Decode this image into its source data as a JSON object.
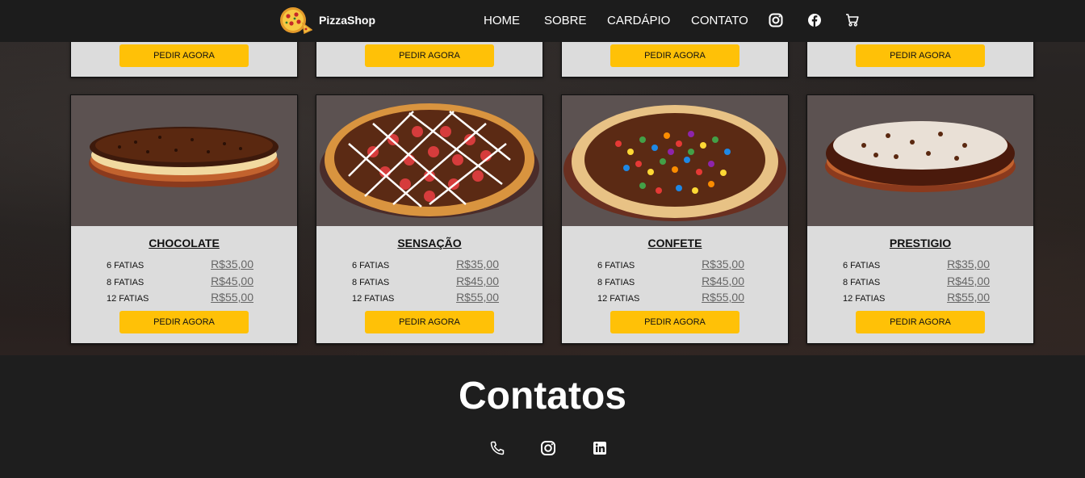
{
  "nav": {
    "brand": "PizzaShop",
    "links": [
      "HOME",
      "SOBRE",
      "CARDÁPIO",
      "CONTATO"
    ],
    "icons": [
      "instagram-icon",
      "facebook-icon",
      "cart-icon"
    ]
  },
  "top_row": {
    "button_label": "PEDIR AGORA"
  },
  "pizzas": [
    {
      "name": "CHOCOLATE",
      "prices": [
        {
          "label": "6 FATIAS",
          "value": "R$35,00"
        },
        {
          "label": "8 FATIAS",
          "value": "R$45,00"
        },
        {
          "label": "12 FATIAS",
          "value": "R$55,00"
        }
      ],
      "button": "PEDIR AGORA"
    },
    {
      "name": "SENSAÇÃO",
      "prices": [
        {
          "label": "6 FATIAS",
          "value": "R$35,00"
        },
        {
          "label": "8 FATIAS",
          "value": "R$45,00"
        },
        {
          "label": "12 FATIAS",
          "value": "R$55,00"
        }
      ],
      "button": "PEDIR AGORA"
    },
    {
      "name": "CONFETE",
      "prices": [
        {
          "label": "6 FATIAS",
          "value": "R$35,00"
        },
        {
          "label": "8 FATIAS",
          "value": "R$45,00"
        },
        {
          "label": "12 FATIAS",
          "value": "R$55,00"
        }
      ],
      "button": "PEDIR AGORA"
    },
    {
      "name": "PRESTIGIO",
      "prices": [
        {
          "label": "6 FATIAS",
          "value": "R$35,00"
        },
        {
          "label": "8 FATIAS",
          "value": "R$45,00"
        },
        {
          "label": "12 FATIAS",
          "value": "R$55,00"
        }
      ],
      "button": "PEDIR AGORA"
    }
  ],
  "contacts": {
    "title": "Contatos",
    "icons": [
      "phone-icon",
      "instagram-icon",
      "linkedin-icon"
    ]
  },
  "colors": {
    "accent": "#ffc107",
    "nav_bg": "#1c1c1c",
    "card_bg": "#dcdcdc",
    "image_bg": "#5c5251"
  }
}
